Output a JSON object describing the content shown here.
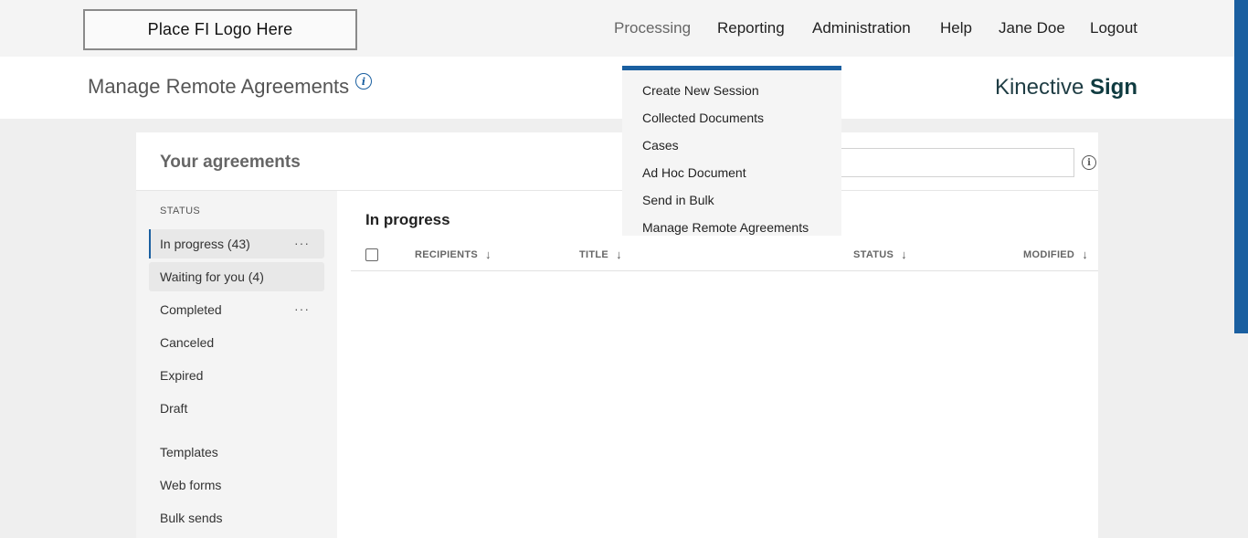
{
  "header": {
    "logo_text": "Place FI Logo Here",
    "nav": [
      "Processing",
      "Reporting",
      "Administration",
      "Help",
      "Jane Doe",
      "Logout"
    ]
  },
  "titlebar": {
    "title": "Manage Remote Agreements",
    "info_glyph": "i",
    "brand_light": "Kinective",
    "brand_bold": "Sign"
  },
  "dropdown": {
    "items": [
      "Create New Session",
      "Collected Documents",
      "Cases",
      "Ad Hoc Document",
      "Send in Bulk",
      "Manage Remote Agreements"
    ]
  },
  "panel": {
    "title": "Your agreements",
    "search": {
      "value": "",
      "placeholder": ""
    },
    "search_info_glyph": "i",
    "status_label": "STATUS",
    "status_items": [
      "In progress (43)",
      "Waiting for you (4)",
      "Completed",
      "Canceled",
      "Expired",
      "Draft"
    ],
    "other_items": [
      "Templates",
      "Web forms",
      "Bulk sends"
    ],
    "more_glyph": "···",
    "content_title": "In progress",
    "columns": [
      "RECIPIENTS",
      "TITLE",
      "STATUS",
      "MODIFIED"
    ],
    "sort_glyph": "↓"
  },
  "colors": {
    "accent": "#1a5fa0",
    "brand": "#0f3b40",
    "background": "#efefef"
  },
  "icons": [
    "info-icon",
    "more-options-icon",
    "sort-down-icon",
    "checkbox-icon"
  ]
}
